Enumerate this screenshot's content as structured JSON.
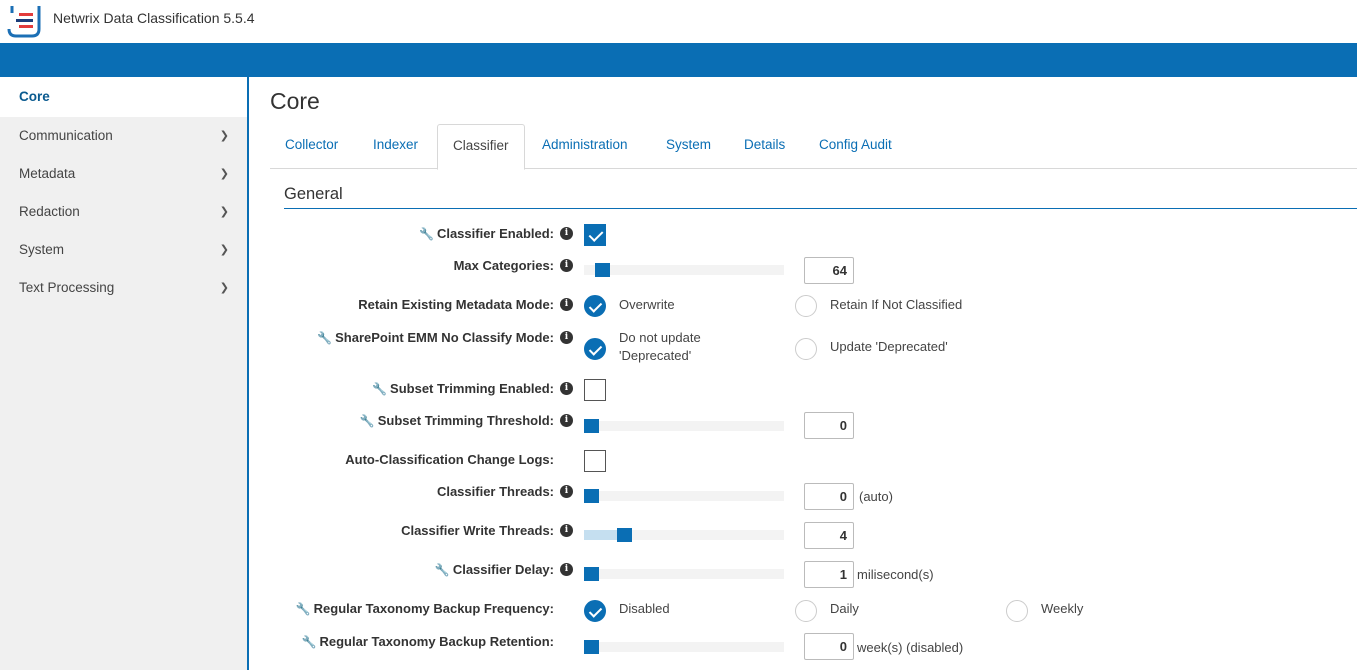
{
  "app": {
    "title": "Netwrix Data Classification 5.5.4"
  },
  "sidebar": {
    "items": [
      {
        "label": "Core",
        "active": true,
        "expandable": false
      },
      {
        "label": "Communication",
        "expandable": true
      },
      {
        "label": "Metadata",
        "expandable": true
      },
      {
        "label": "Redaction",
        "expandable": true
      },
      {
        "label": "System",
        "expandable": true
      },
      {
        "label": "Text Processing",
        "expandable": true
      }
    ]
  },
  "main": {
    "title": "Core",
    "tabs": [
      {
        "label": "Collector"
      },
      {
        "label": "Indexer"
      },
      {
        "label": "Classifier",
        "active": true
      },
      {
        "label": "Administration"
      },
      {
        "label": "System"
      },
      {
        "label": "Details"
      },
      {
        "label": "Config Audit"
      }
    ],
    "section_title": "General"
  },
  "settings": {
    "classifier_enabled": {
      "label": "Classifier Enabled:",
      "checked": true
    },
    "max_categories": {
      "label": "Max Categories:",
      "value": "64",
      "level": 0.06
    },
    "retain_metadata": {
      "label": "Retain Existing Metadata Mode:",
      "options": [
        "Overwrite",
        "Retain If Not Classified"
      ],
      "selected": "Overwrite"
    },
    "sharepoint_emm": {
      "label": "SharePoint EMM No Classify Mode:",
      "option1_line1": "Do not update",
      "option1_line2": "'Deprecated'",
      "option2": "Update 'Deprecated'",
      "selected": "Do not update 'Deprecated'"
    },
    "subset_trimming_enabled": {
      "label": "Subset Trimming Enabled:",
      "checked": false
    },
    "subset_trimming_threshold": {
      "label": "Subset Trimming Threshold:",
      "value": "0",
      "level": 0
    },
    "auto_classification_logs": {
      "label": "Auto-Classification Change Logs:",
      "checked": false
    },
    "classifier_threads": {
      "label": "Classifier Threads:",
      "value": "0",
      "suffix": "(auto)",
      "level": 0
    },
    "classifier_write_threads": {
      "label": "Classifier Write Threads:",
      "value": "4",
      "level": 0.18
    },
    "classifier_delay": {
      "label": "Classifier Delay:",
      "value": "1",
      "suffix": "milisecond(s)",
      "level": 0
    },
    "backup_frequency": {
      "label": "Regular Taxonomy Backup Frequency:",
      "options": [
        "Disabled",
        "Daily",
        "Weekly"
      ],
      "selected": "Disabled"
    },
    "backup_retention": {
      "label": "Regular Taxonomy Backup Retention:",
      "value": "0",
      "suffix": "week(s) (disabled)",
      "level": 0
    }
  },
  "colors": {
    "accent": "#0a6eb4",
    "sidebar_bg": "#f0f0f0"
  },
  "icons": {
    "wrench": "wrench-icon",
    "info": "info-icon",
    "chevron": "chevron-down-icon",
    "logo": "netwrix-logo-icon"
  }
}
